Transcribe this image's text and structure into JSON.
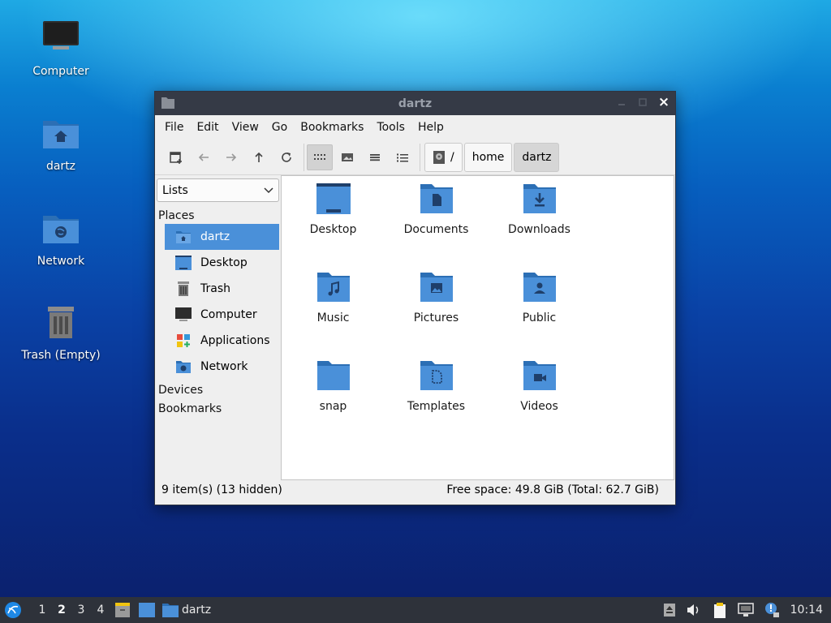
{
  "desktop": {
    "icons": [
      {
        "label": "Computer"
      },
      {
        "label": "dartz"
      },
      {
        "label": "Network"
      },
      {
        "label": "Trash (Empty)"
      }
    ]
  },
  "window": {
    "title": "dartz",
    "close_glyph": "×"
  },
  "menu": [
    "File",
    "Edit",
    "View",
    "Go",
    "Bookmarks",
    "Tools",
    "Help"
  ],
  "toolbar": {
    "breadcrumb": {
      "root": "/",
      "items": [
        "home",
        "dartz"
      ]
    }
  },
  "sidebar": {
    "select_value": "Lists",
    "places_title": "Places",
    "places": [
      "dartz",
      "Desktop",
      "Trash",
      "Computer",
      "Applications",
      "Network"
    ],
    "devices_title": "Devices",
    "bookmarks_title": "Bookmarks"
  },
  "files": [
    "Desktop",
    "Documents",
    "Downloads",
    "Music",
    "Pictures",
    "Public",
    "snap",
    "Templates",
    "Videos"
  ],
  "status": {
    "left": "9 item(s) (13 hidden)",
    "right": "Free space: 49.8 GiB (Total: 62.7 GiB)"
  },
  "taskbar": {
    "workspaces": [
      "1",
      "2",
      "3",
      "4"
    ],
    "current_workspace": "2",
    "task_label": "dartz",
    "clock": "10:14"
  },
  "colors": {
    "folder": "#4a90d9",
    "folder_dark": "#2c6fb5",
    "selection": "#4a90d9",
    "titlebar": "#353a46",
    "taskbar": "#2e323a"
  }
}
